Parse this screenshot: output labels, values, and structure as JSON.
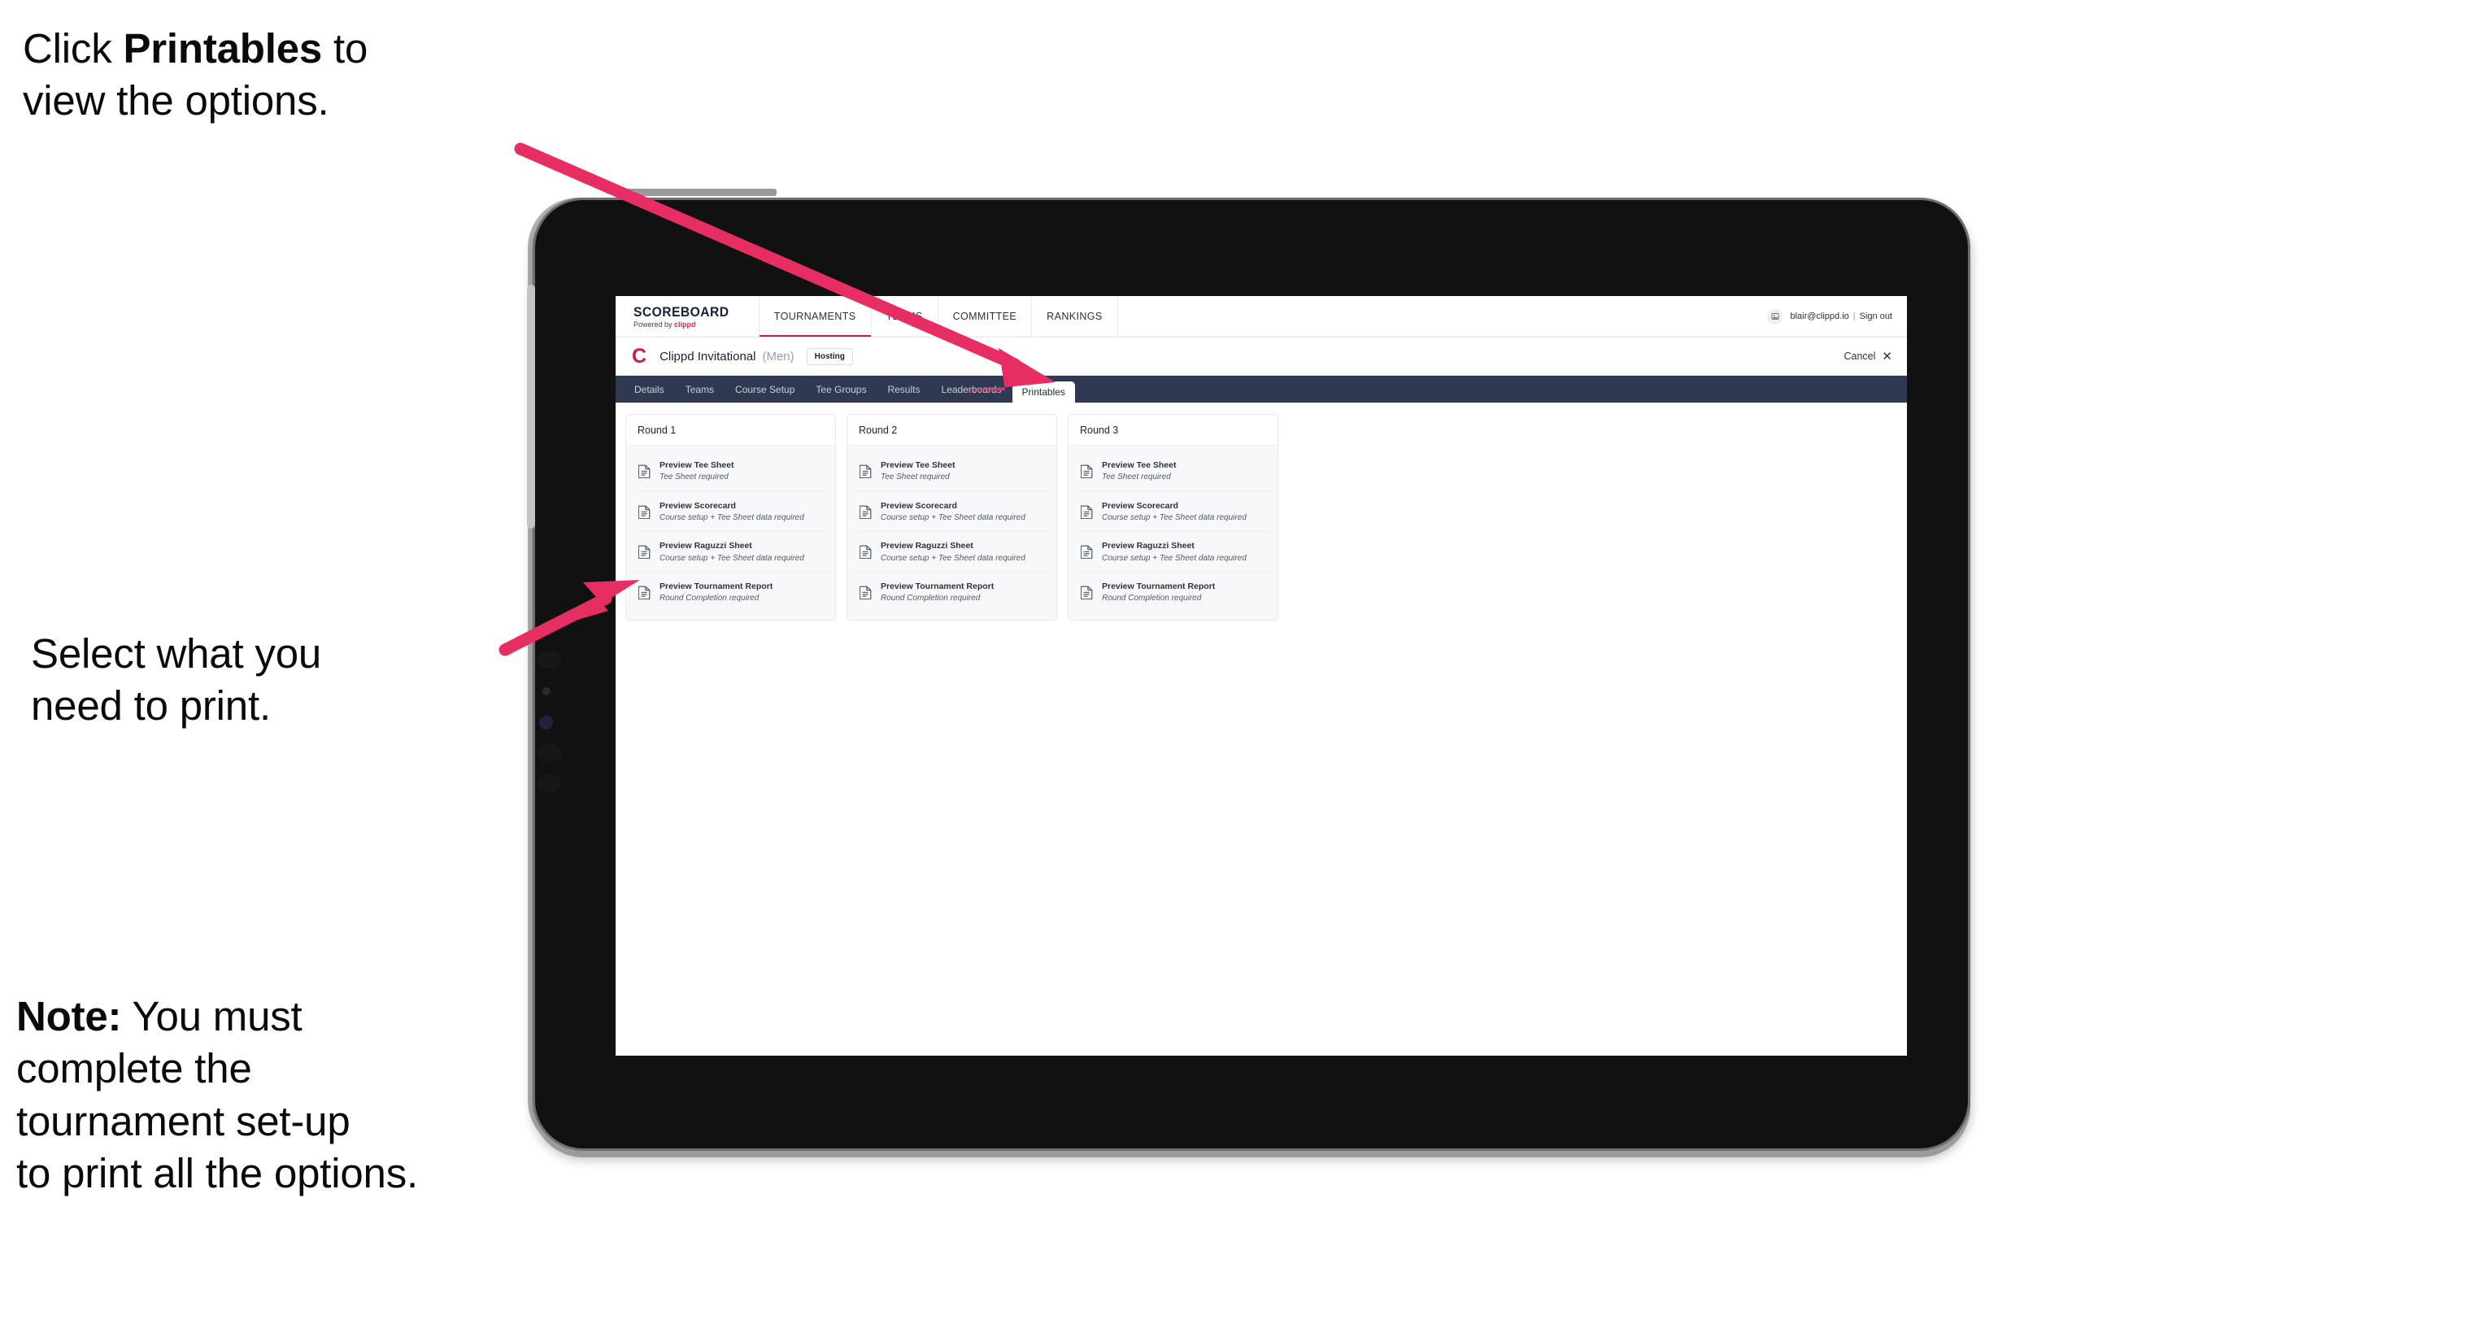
{
  "annotations": [
    {
      "id": "annot-1",
      "segments": [
        {
          "text": "Click ",
          "bold": false
        },
        {
          "text": "Printables",
          "bold": true
        },
        {
          "text": " to\nview the options.",
          "bold": false
        }
      ]
    },
    {
      "id": "annot-2",
      "segments": [
        {
          "text": "Select what you\n need to print.",
          "bold": false
        }
      ]
    },
    {
      "id": "annot-3",
      "segments": [
        {
          "text": "Note:",
          "bold": true
        },
        {
          "text": " You must\ncomplete the\ntournament set-up\nto print all the options.",
          "bold": false
        }
      ]
    }
  ],
  "colors": {
    "accent_pink": "#e8195b",
    "arrow_pink": "#e62e63",
    "subnav_dark": "#2f3a52",
    "tournament_logo": "#e0114f",
    "active_underline": "#b0284f"
  },
  "browser": {
    "appbar": {
      "brand_title": "SCOREBOARD",
      "brand_sub_prefix": "Powered by ",
      "brand_sub_name": "clippd",
      "nav_items": [
        {
          "label": "TOURNAMENTS",
          "active": true
        },
        {
          "label": "TEAMS",
          "active": false
        },
        {
          "label": "COMMITTEE",
          "active": false
        },
        {
          "label": "RANKINGS",
          "active": false
        }
      ],
      "user_email": "blair@clippd.io",
      "separator": "|",
      "sign_out_label": "Sign out"
    },
    "tournament_bar": {
      "logo_letter": "C",
      "name": "Clippd Invitational",
      "gender": "(Men)",
      "badge": "Hosting",
      "cancel_label": "Cancel",
      "cancel_icon": "✕"
    },
    "subnav": {
      "items": [
        {
          "label": "Details",
          "active": false
        },
        {
          "label": "Teams",
          "active": false
        },
        {
          "label": "Course Setup",
          "active": false
        },
        {
          "label": "Tee Groups",
          "active": false
        },
        {
          "label": "Results",
          "active": false
        },
        {
          "label": "Leaderboards",
          "active": false
        },
        {
          "label": "Printables",
          "active": true
        }
      ]
    },
    "rounds": [
      {
        "title": "Round 1",
        "items": [
          {
            "title": "Preview Tee Sheet",
            "sub": "Tee Sheet required"
          },
          {
            "title": "Preview Scorecard",
            "sub": "Course setup + Tee Sheet data required"
          },
          {
            "title": "Preview Raguzzi Sheet",
            "sub": "Course setup + Tee Sheet data required"
          },
          {
            "title": "Preview Tournament Report",
            "sub": "Round Completion required"
          }
        ]
      },
      {
        "title": "Round 2",
        "items": [
          {
            "title": "Preview Tee Sheet",
            "sub": "Tee Sheet required"
          },
          {
            "title": "Preview Scorecard",
            "sub": "Course setup + Tee Sheet data required"
          },
          {
            "title": "Preview Raguzzi Sheet",
            "sub": "Course setup + Tee Sheet data required"
          },
          {
            "title": "Preview Tournament Report",
            "sub": "Round Completion required"
          }
        ]
      },
      {
        "title": "Round 3",
        "items": [
          {
            "title": "Preview Tee Sheet",
            "sub": "Tee Sheet required"
          },
          {
            "title": "Preview Scorecard",
            "sub": "Course setup + Tee Sheet data required"
          },
          {
            "title": "Preview Raguzzi Sheet",
            "sub": "Course setup + Tee Sheet data required"
          },
          {
            "title": "Preview Tournament Report",
            "sub": "Round Completion required"
          }
        ]
      }
    ]
  }
}
